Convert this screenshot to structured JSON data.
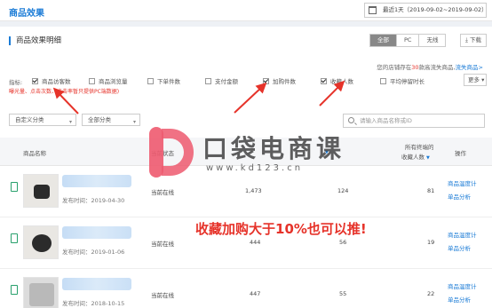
{
  "header": {
    "title": "商品效果",
    "date_range": "最近1天（2019-09-02~2019-09-02）"
  },
  "section": {
    "title": "商品效果明细",
    "tabs": [
      {
        "label": "全部",
        "active": true
      },
      {
        "label": "PC",
        "active": false
      },
      {
        "label": "无线",
        "active": false
      }
    ],
    "download_label": "下载"
  },
  "cache_note": {
    "prefix": "您的店铺存在",
    "count": "30",
    "middle": "款高流失商品,",
    "link": "流失商品>"
  },
  "metrics": {
    "label": "指标:",
    "items": [
      {
        "label": "商品访客数",
        "checked": true
      },
      {
        "label": "商品浏览量",
        "checked": false
      },
      {
        "label": "下单件数",
        "checked": false
      },
      {
        "label": "支付金额",
        "checked": false
      },
      {
        "label": "加购件数",
        "checked": true
      },
      {
        "label": "收藏人数",
        "checked": true
      },
      {
        "label": "平均停留时长",
        "checked": false
      }
    ],
    "more_label": "更多",
    "note": "曝光量、点击次数、点击率暂只提供PC端数据)"
  },
  "filters": {
    "category1": "自定义分类",
    "category2": "全部分类",
    "search_placeholder": "请输入商品名称或ID"
  },
  "table": {
    "headers": {
      "name": "商品名称",
      "status": "当前状态",
      "extra_top": "所有终端的",
      "favorites": "收藏人数",
      "op": "操作"
    },
    "rows": [
      {
        "publish": "发布时间：2019-04-30",
        "status": "当前在线",
        "visitors": "1,473",
        "add_cart": "124",
        "favorites": "81"
      },
      {
        "publish": "发布时间：2019-01-06",
        "status": "当前在线",
        "visitors": "444",
        "add_cart": "56",
        "favorites": "19"
      },
      {
        "publish": "发布时间：2018-10-15",
        "status": "当前在线",
        "visitors": "447",
        "add_cart": "55",
        "favorites": "22"
      }
    ],
    "op_links": {
      "trend": "商品温度计",
      "analysis": "单品分析"
    }
  },
  "watermark": {
    "title": "口袋电商课",
    "url": "www.kd123.cn"
  },
  "overlay_text": "收藏加购大于10%也可以推!",
  "colors": {
    "accent": "#1a7bd6",
    "red": "#e6332a",
    "online_icon": "#28a06c"
  }
}
